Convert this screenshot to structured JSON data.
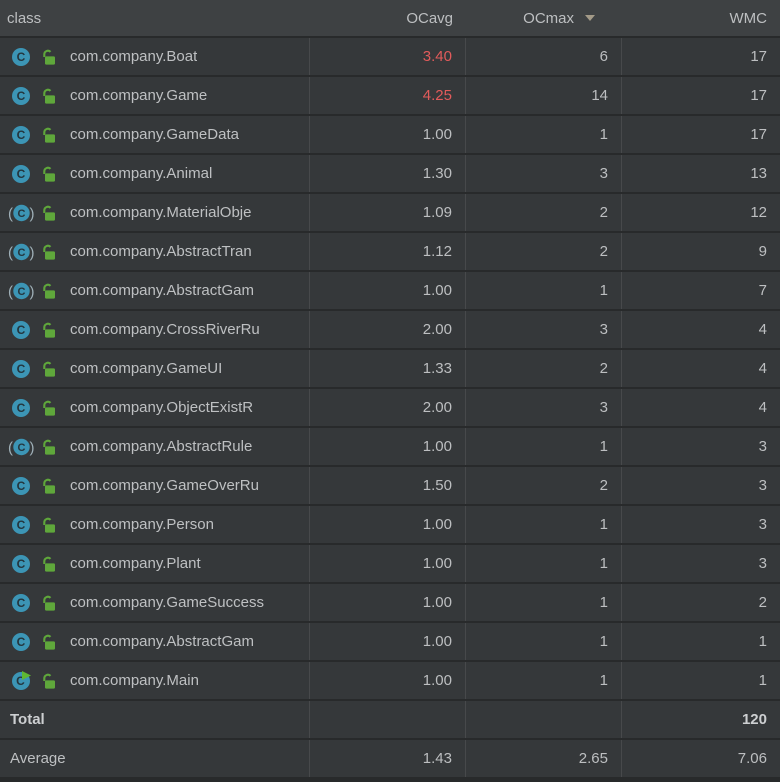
{
  "table": {
    "columns": [
      {
        "label": "class",
        "align": "left"
      },
      {
        "label": "OCavg",
        "align": "right"
      },
      {
        "label": "OCmax",
        "align": "right",
        "sorted": "desc",
        "sort_icon": "▼"
      },
      {
        "label": "WMC",
        "align": "right"
      }
    ],
    "rows": [
      {
        "name": "com.company.Boat",
        "icon": "class-icon",
        "lock": "lock-icon",
        "ocavg": "3.40",
        "ocavg_alert": true,
        "ocmax": "6",
        "wmc": "17"
      },
      {
        "name": "com.company.Game",
        "icon": "class-icon",
        "lock": "lock-icon",
        "ocavg": "4.25",
        "ocavg_alert": true,
        "ocmax": "14",
        "wmc": "17"
      },
      {
        "name": "com.company.GameData",
        "icon": "class-icon",
        "lock": "lock-icon",
        "ocavg": "1.00",
        "ocavg_alert": false,
        "ocmax": "1",
        "wmc": "17"
      },
      {
        "name": "com.company.Animal",
        "icon": "class-icon",
        "lock": "lock-icon",
        "ocavg": "1.30",
        "ocavg_alert": false,
        "ocmax": "3",
        "wmc": "13"
      },
      {
        "name": "com.company.MaterialObje",
        "icon": "abstract-class-icon",
        "lock": "lock-icon",
        "ocavg": "1.09",
        "ocavg_alert": false,
        "ocmax": "2",
        "wmc": "12"
      },
      {
        "name": "com.company.AbstractTran",
        "icon": "abstract-class-icon",
        "lock": "lock-icon",
        "ocavg": "1.12",
        "ocavg_alert": false,
        "ocmax": "2",
        "wmc": "9"
      },
      {
        "name": "com.company.AbstractGam",
        "icon": "abstract-class-icon",
        "lock": "lock-icon",
        "ocavg": "1.00",
        "ocavg_alert": false,
        "ocmax": "1",
        "wmc": "7"
      },
      {
        "name": "com.company.CrossRiverRu",
        "icon": "class-icon",
        "lock": "lock-icon",
        "ocavg": "2.00",
        "ocavg_alert": false,
        "ocmax": "3",
        "wmc": "4"
      },
      {
        "name": "com.company.GameUI",
        "icon": "class-icon",
        "lock": "lock-icon",
        "ocavg": "1.33",
        "ocavg_alert": false,
        "ocmax": "2",
        "wmc": "4"
      },
      {
        "name": "com.company.ObjectExistR",
        "icon": "class-icon",
        "lock": "lock-icon",
        "ocavg": "2.00",
        "ocavg_alert": false,
        "ocmax": "3",
        "wmc": "4"
      },
      {
        "name": "com.company.AbstractRule",
        "icon": "abstract-class-icon",
        "lock": "lock-icon",
        "ocavg": "1.00",
        "ocavg_alert": false,
        "ocmax": "1",
        "wmc": "3"
      },
      {
        "name": "com.company.GameOverRu",
        "icon": "class-icon",
        "lock": "lock-icon",
        "ocavg": "1.50",
        "ocavg_alert": false,
        "ocmax": "2",
        "wmc": "3"
      },
      {
        "name": "com.company.Person",
        "icon": "class-icon",
        "lock": "lock-icon",
        "ocavg": "1.00",
        "ocavg_alert": false,
        "ocmax": "1",
        "wmc": "3"
      },
      {
        "name": "com.company.Plant",
        "icon": "class-icon",
        "lock": "lock-icon",
        "ocavg": "1.00",
        "ocavg_alert": false,
        "ocmax": "1",
        "wmc": "3"
      },
      {
        "name": "com.company.GameSuccess",
        "icon": "class-icon",
        "lock": "lock-icon",
        "ocavg": "1.00",
        "ocavg_alert": false,
        "ocmax": "1",
        "wmc": "2"
      },
      {
        "name": "com.company.AbstractGam",
        "icon": "class-icon",
        "lock": "lock-icon",
        "ocavg": "1.00",
        "ocavg_alert": false,
        "ocmax": "1",
        "wmc": "1"
      },
      {
        "name": "com.company.Main",
        "icon": "runnable-class-icon",
        "lock": "lock-icon",
        "ocavg": "1.00",
        "ocavg_alert": false,
        "ocmax": "1",
        "wmc": "1"
      }
    ],
    "footer": [
      {
        "label": "Total",
        "ocavg": "",
        "ocmax": "",
        "wmc": "120",
        "bold": true
      },
      {
        "label": "Average",
        "ocavg": "1.43",
        "ocmax": "2.65",
        "wmc": "7.06",
        "bold": false
      }
    ]
  },
  "colors": {
    "header_bg": "#3e4143",
    "row_bg": "#35383a",
    "grid_vertical": "#47494b",
    "grid_horizontal": "#282a2b",
    "text": "#bec0c2",
    "alert_red": "#e25b5b",
    "class_icon_fill": "#3c95b5",
    "class_icon_letter": "#24363e",
    "abstract_parens": "#9fb0b8",
    "lock_green": "#5fa73b",
    "run_arrow_green": "#5fb832",
    "sort_arrow": "#a39a88"
  }
}
